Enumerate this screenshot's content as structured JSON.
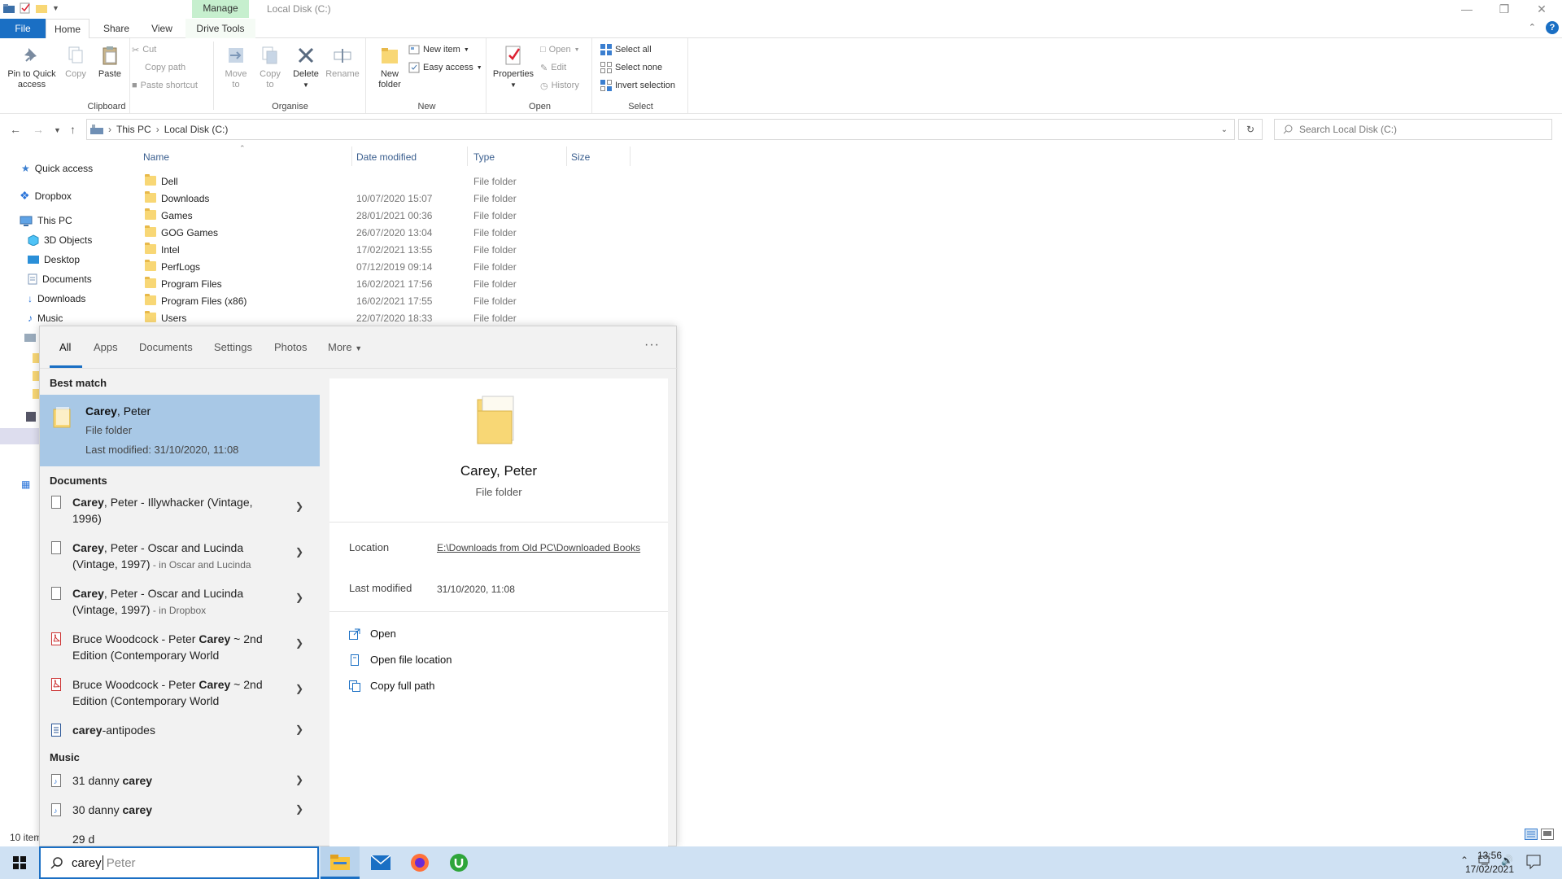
{
  "window": {
    "title": "Local Disk (C:)",
    "contextual_tab_group": "Manage",
    "controls": {
      "minimize": "—",
      "restore": "❐",
      "close": "✕"
    }
  },
  "ribbon_tabs": [
    "File",
    "Home",
    "Share",
    "View",
    "Drive Tools"
  ],
  "ribbon": {
    "clipboard": {
      "group": "Clipboard",
      "pin_line1": "Pin to Quick",
      "pin_line2": "access",
      "copy": "Copy",
      "paste": "Paste",
      "cut": "Cut",
      "copy_path": "Copy path",
      "paste_shortcut": "Paste shortcut"
    },
    "organise": {
      "group": "Organise",
      "move_line1": "Move",
      "move_line2": "to",
      "copy_line1": "Copy",
      "copy_line2": "to",
      "delete": "Delete",
      "rename": "Rename"
    },
    "new": {
      "group": "New",
      "folder_line1": "New",
      "folder_line2": "folder",
      "new_item": "New item",
      "easy_access": "Easy access"
    },
    "open": {
      "group": "Open",
      "properties": "Properties",
      "open": "Open",
      "edit": "Edit",
      "history": "History"
    },
    "select": {
      "group": "Select",
      "select_all": "Select all",
      "select_none": "Select none",
      "invert": "Invert selection"
    }
  },
  "address": {
    "crumbs": [
      "This PC",
      "Local Disk (C:)"
    ],
    "search_placeholder": "Search Local Disk (C:)"
  },
  "nav_pane": [
    "Quick access",
    "Dropbox",
    "This PC",
    "3D Objects",
    "Desktop",
    "Documents",
    "Downloads",
    "Music"
  ],
  "columns": [
    "Name",
    "Date modified",
    "Type",
    "Size"
  ],
  "files": [
    {
      "name": "Dell",
      "date": "",
      "type": "File folder"
    },
    {
      "name": "Downloads",
      "date": "10/07/2020 15:07",
      "type": "File folder"
    },
    {
      "name": "Games",
      "date": "28/01/2021 00:36",
      "type": "File folder"
    },
    {
      "name": "GOG Games",
      "date": "26/07/2020 13:04",
      "type": "File folder"
    },
    {
      "name": "Intel",
      "date": "17/02/2021 13:55",
      "type": "File folder"
    },
    {
      "name": "PerfLogs",
      "date": "07/12/2019 09:14",
      "type": "File folder"
    },
    {
      "name": "Program Files",
      "date": "16/02/2021 17:56",
      "type": "File folder"
    },
    {
      "name": "Program Files (x86)",
      "date": "16/02/2021 17:55",
      "type": "File folder"
    },
    {
      "name": "Users",
      "date": "22/07/2020 18:33",
      "type": "File folder"
    }
  ],
  "status": "10 item",
  "search_flyout": {
    "tabs": [
      "All",
      "Apps",
      "Documents",
      "Settings",
      "Photos",
      "More"
    ],
    "more_dots": "···",
    "best_match_heading": "Best match",
    "best_match": {
      "title_bold": "Carey",
      "title_rest": ", Peter",
      "type": "File folder",
      "modified": "Last modified: 31/10/2020, 11:08"
    },
    "documents_heading": "Documents",
    "documents": [
      {
        "bold": "Carey",
        "text": ", Peter - Illywhacker (Vintage, 1996)",
        "sub": "",
        "icon": "doc"
      },
      {
        "bold": "Carey",
        "text": ", Peter - Oscar and Lucinda (Vintage, 1997)",
        "sub": " - in Oscar and Lucinda",
        "icon": "doc"
      },
      {
        "bold": "Carey",
        "text": ", Peter - Oscar and Lucinda (Vintage, 1997)",
        "sub": " - in Dropbox",
        "icon": "doc"
      },
      {
        "pre": "Bruce Woodcock - Peter ",
        "bold": "Carey",
        "text": " ~ 2nd Edition (Contemporary World",
        "sub": "",
        "icon": "pdf"
      },
      {
        "pre": "Bruce Woodcock - Peter ",
        "bold": "Carey",
        "text": " ~ 2nd Edition (Contemporary World",
        "sub": "",
        "icon": "pdf"
      },
      {
        "bold": "carey",
        "text": "-antipodes",
        "sub": "",
        "icon": "word"
      }
    ],
    "music_heading": "Music",
    "music": [
      {
        "pre": "31 danny ",
        "bold": "carey"
      },
      {
        "pre": "30 danny ",
        "bold": "carey"
      },
      {
        "pre": "29 d",
        "bold": ""
      }
    ],
    "preview": {
      "title": "Carey, Peter",
      "type": "File folder",
      "location_label": "Location",
      "location_value": "E:\\Downloads from Old PC\\Downloaded Books",
      "modified_label": "Last modified",
      "modified_value": "31/10/2020, 11:08",
      "actions": [
        "Open",
        "Open file location",
        "Copy full path"
      ]
    }
  },
  "taskbar": {
    "search_typed": "carey",
    "search_suggestion": "Peter",
    "time": "13:56",
    "date": "17/02/2021"
  },
  "colors": {
    "accent": "#1a6fc4",
    "best_match_bg": "#a8c8e6",
    "taskbar": "#cfe1f3",
    "manage_tab": "#c6efce"
  }
}
